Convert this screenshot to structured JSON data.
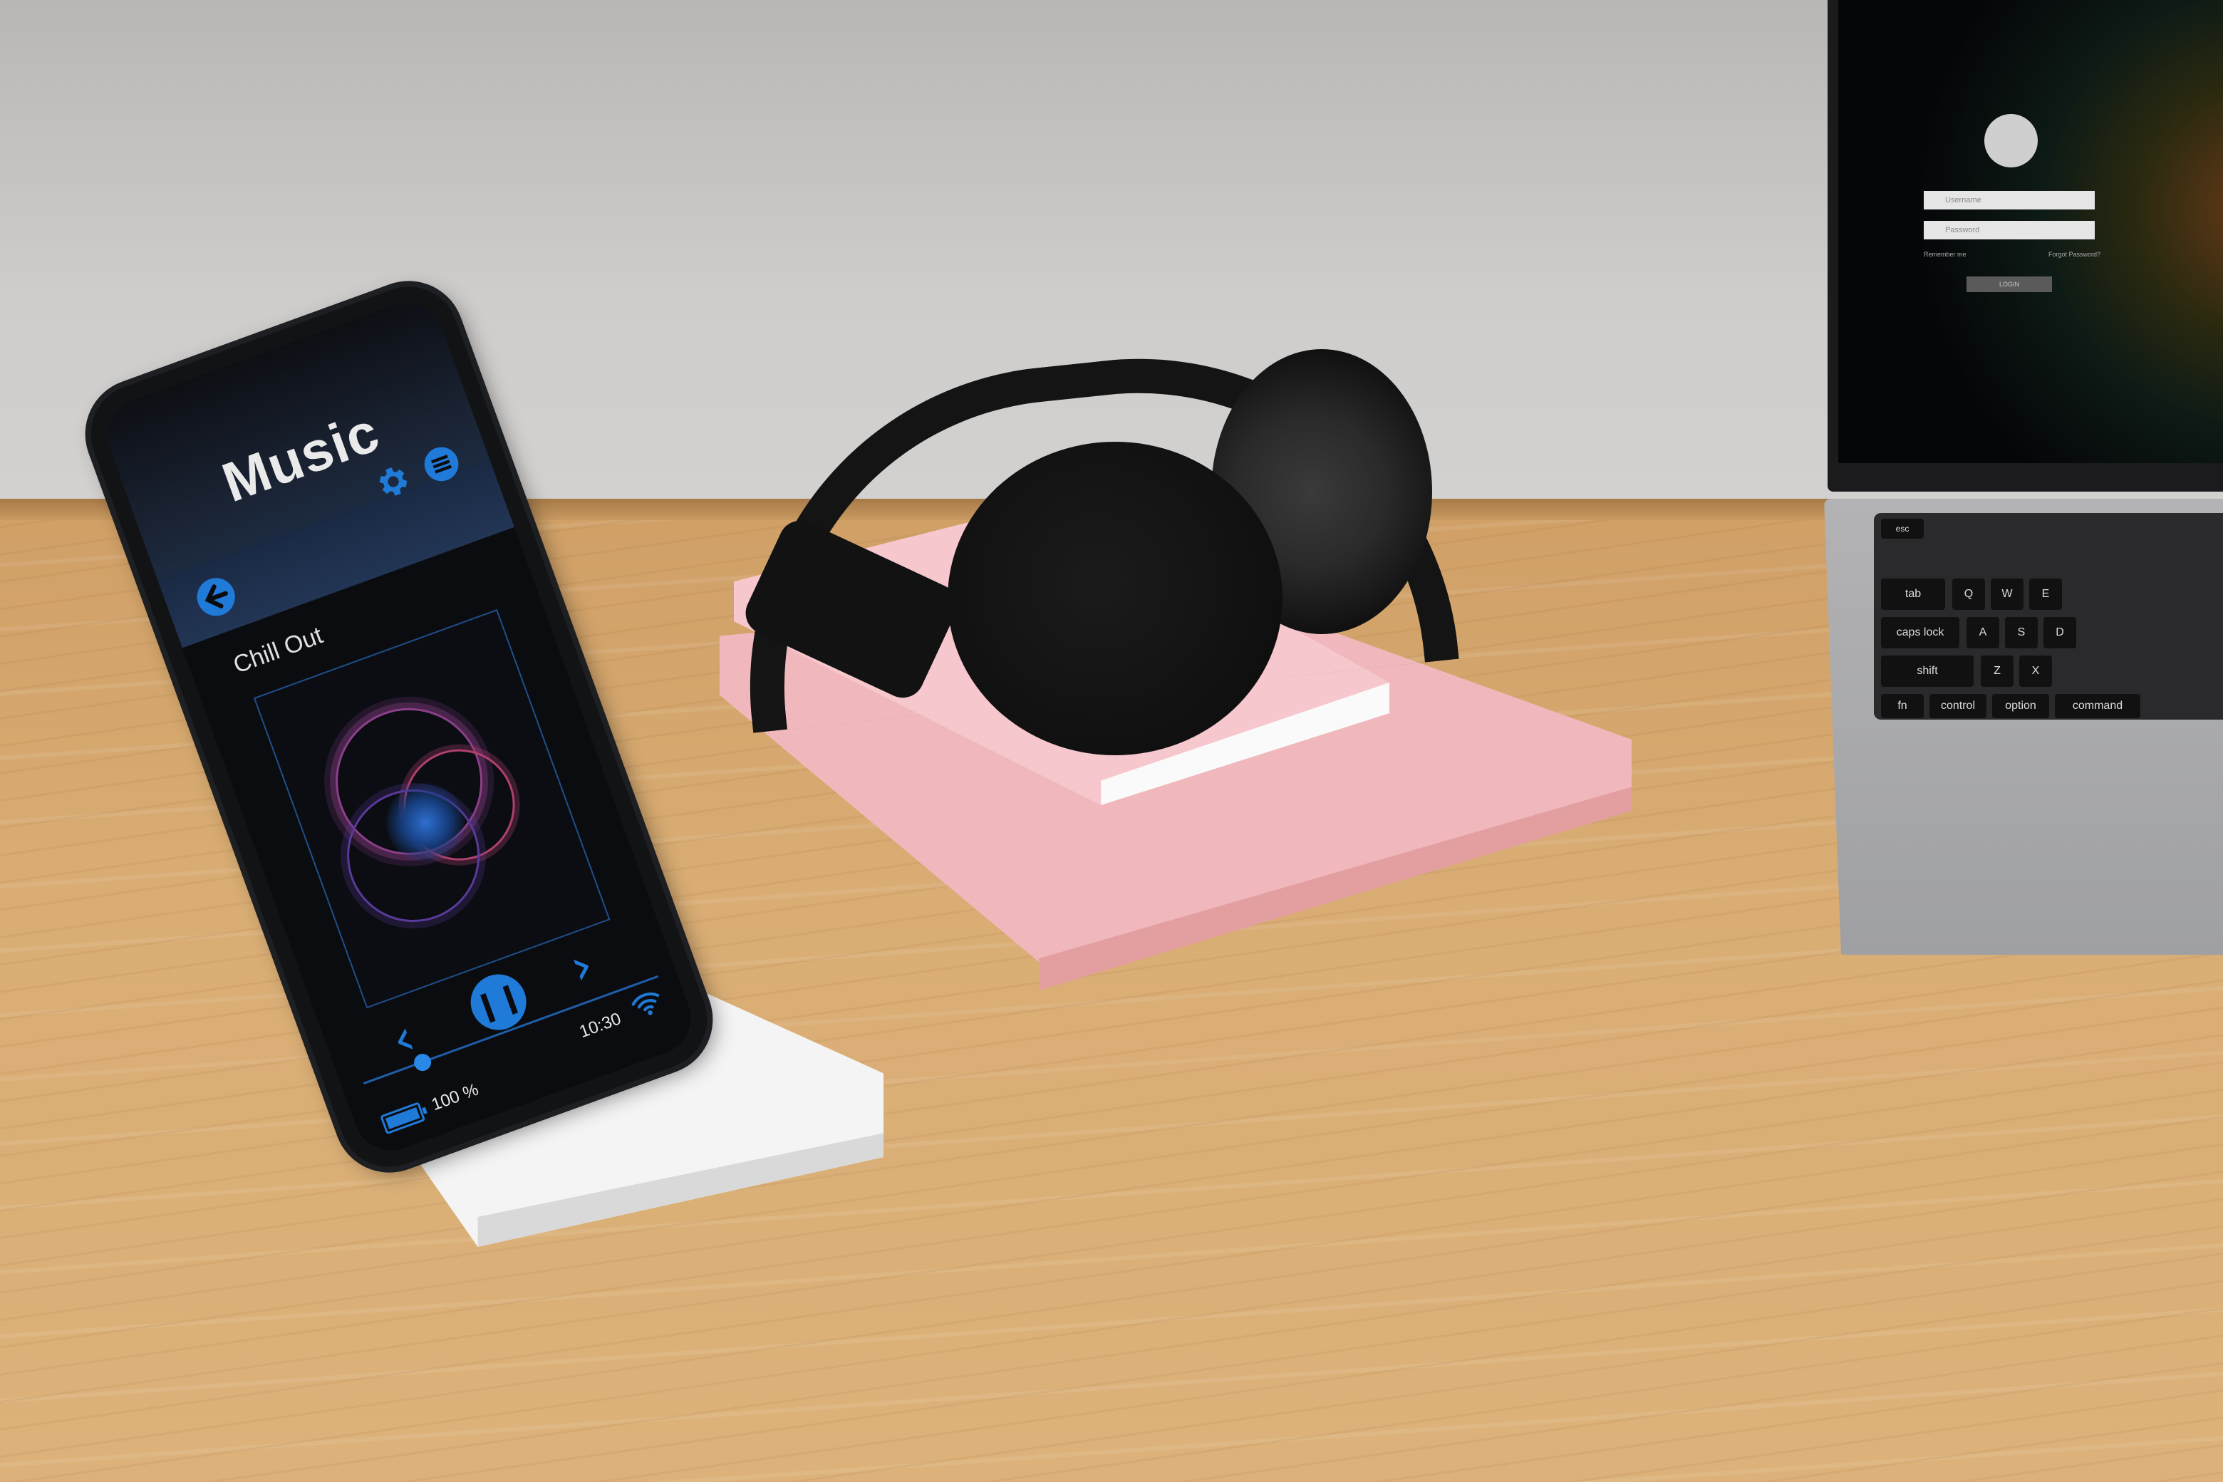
{
  "phone_app": {
    "title": "Music",
    "track_title": "Chill Out",
    "time": "10:30",
    "battery": "100 %",
    "progress": 0.2,
    "icons": {
      "back": "back-arrow-icon",
      "settings": "gear-icon",
      "menu": "menu-icon",
      "play_pause": "pause-icon",
      "previous": "chevron-left-icon",
      "next": "chevron-right-icon",
      "wifi": "wifi-icon",
      "battery": "battery-icon"
    },
    "accent_color": "#1f7ad8"
  },
  "laptop_login": {
    "username_placeholder": "Username",
    "password_placeholder": "Password",
    "remember_me": "Remember me",
    "forgot_password": "Forgot Password?",
    "login_button": "LOGIN"
  },
  "laptop_keyboard": {
    "keys": [
      "esc",
      "tab",
      "caps lock",
      "shift",
      "fn",
      "control",
      "option",
      "command",
      "Q",
      "W",
      "E",
      "A",
      "S",
      "D",
      "Z",
      "X"
    ]
  }
}
